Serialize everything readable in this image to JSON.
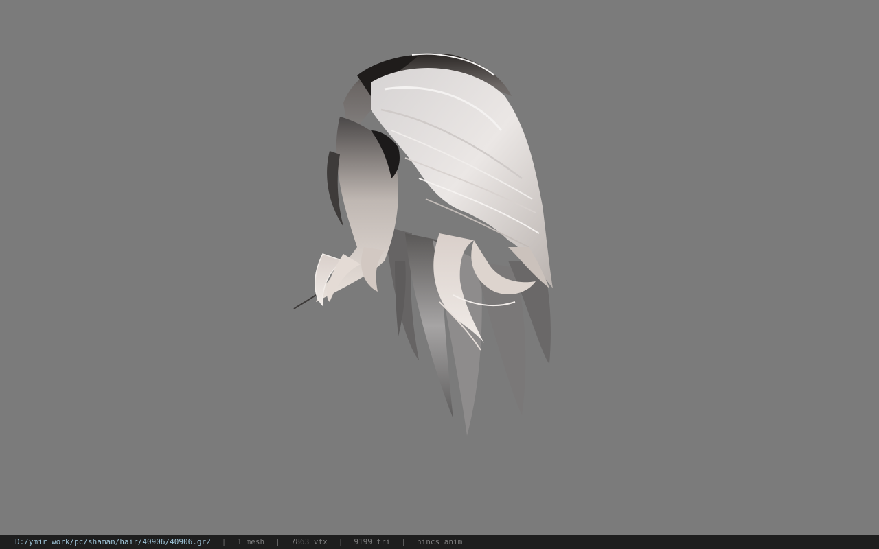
{
  "viewport": {
    "background": "#7b7b7b",
    "model": "hair-mesh"
  },
  "status": {
    "path": "D:/ymir work/pc/shaman/hair/40906/40906.gr2",
    "separator": "|",
    "meshes": "1 mesh",
    "vertices": "7863 vtx",
    "triangles": "9199 tri",
    "anim": "nincs anim"
  },
  "colors": {
    "statusbar_bg": "#1e1e1e",
    "path_text": "#9ec3d6",
    "stat_text": "#7c7c7c"
  }
}
